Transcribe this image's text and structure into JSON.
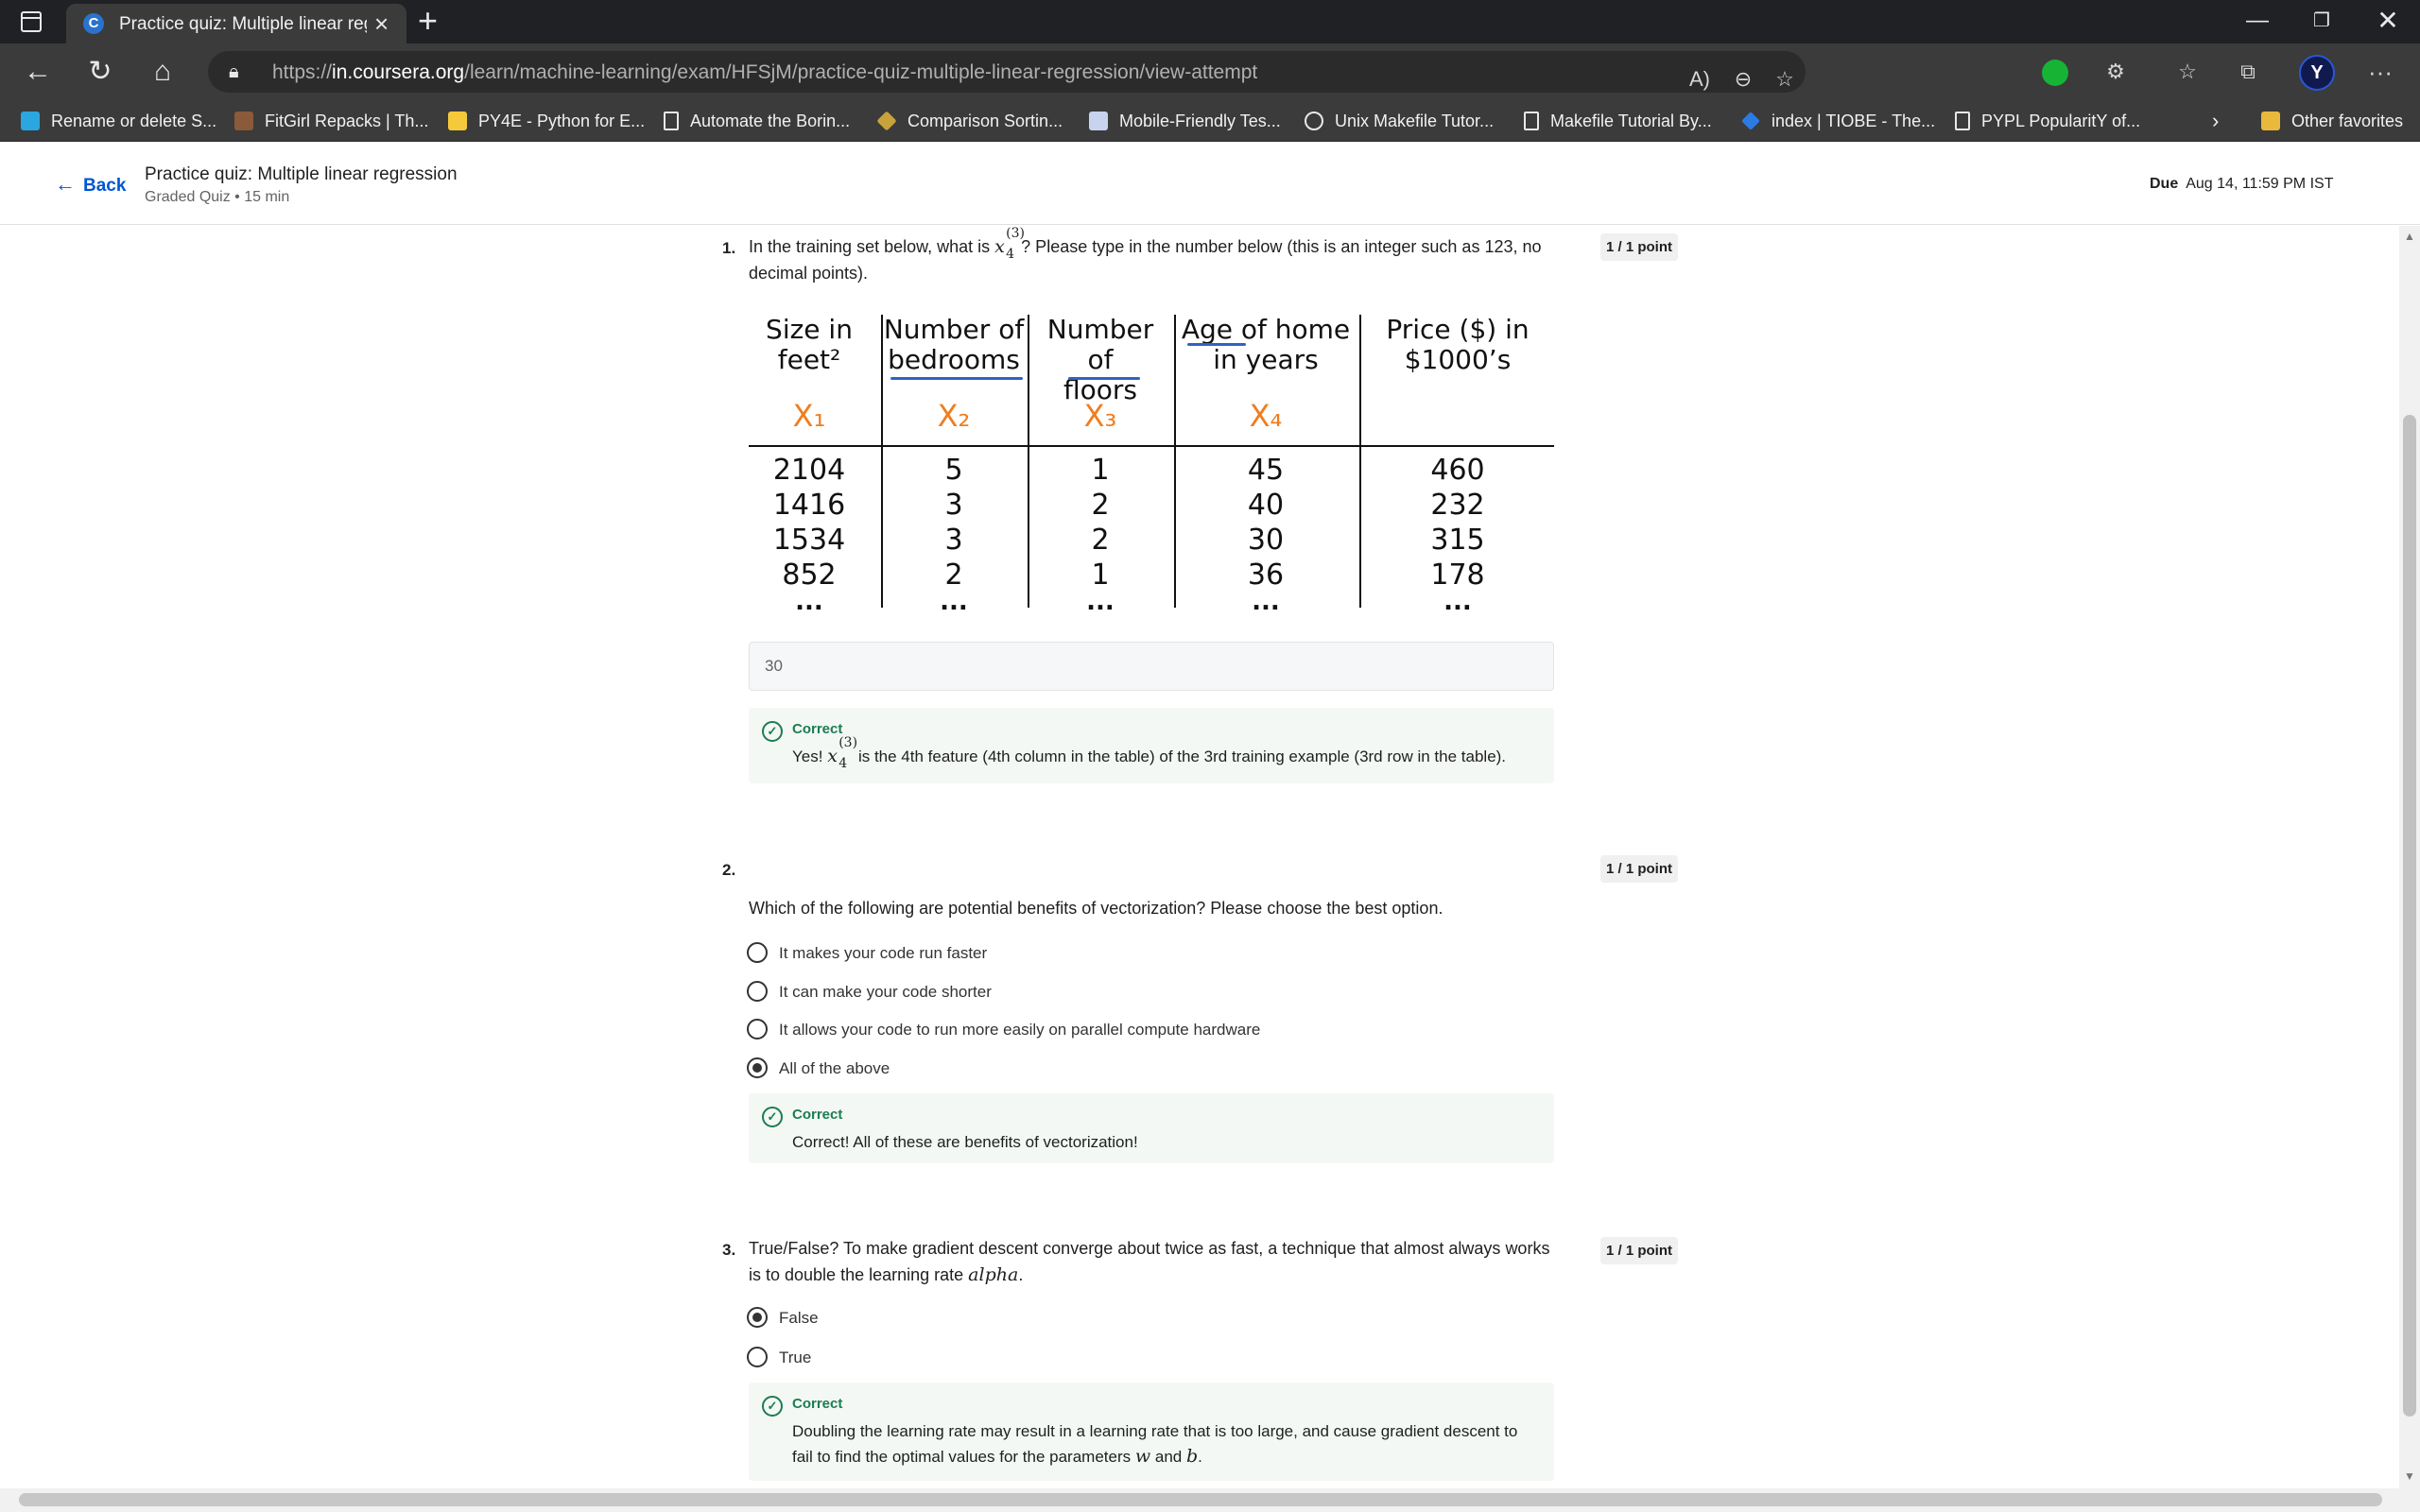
{
  "browser": {
    "tab_title": "Practice quiz: Multiple linear regr",
    "tab_favicon": "C",
    "url_prefix": "https://",
    "url_host": "in.coursera.org",
    "url_path": "/learn/machine-learning/exam/HFSjM/practice-quiz-multiple-linear-regression/view-attempt",
    "profile_initial": "Y",
    "favorites": [
      {
        "label": "Rename or delete S...",
        "icon": "kaggle-k-icon"
      },
      {
        "label": "FitGirl Repacks | Th...",
        "icon": "avatar-icon"
      },
      {
        "label": "PY4E - Python for E...",
        "icon": "python-icon"
      },
      {
        "label": "Automate the Borin...",
        "icon": "page-icon"
      },
      {
        "label": "Comparison Sortin...",
        "icon": "diamond-icon"
      },
      {
        "label": "Mobile-Friendly Tes...",
        "icon": "mobile-test-icon"
      },
      {
        "label": "Unix Makefile Tutor...",
        "icon": "unix-icon"
      },
      {
        "label": "Makefile Tutorial By...",
        "icon": "page-icon"
      },
      {
        "label": "index | TIOBE - The...",
        "icon": "tiobe-icon"
      },
      {
        "label": "PYPL PopularitY of...",
        "icon": "page-icon"
      }
    ],
    "other_favorites": "Other favorites"
  },
  "header": {
    "back_label": "Back",
    "title": "Practice quiz: Multiple linear regression",
    "subtitle": "Graded Quiz • 15 min",
    "due_label": "Due",
    "due_value": "Aug 14, 11:59 PM IST"
  },
  "q1": {
    "number": "1.",
    "text_before": "In the training set below, what is",
    "math_var": "x",
    "math_sup": "(3)",
    "math_sub": "4",
    "text_after": "? Please type in the number below (this is an integer such as 123, no decimal points).",
    "points": "1 / 1 point",
    "table": {
      "headers": [
        {
          "line1": "Size in",
          "line2": "feet²"
        },
        {
          "line1": "Number of",
          "line2": "bedrooms"
        },
        {
          "line1": "Number of",
          "line2": "floors"
        },
        {
          "line1": "Age of home",
          "line2": "in years"
        },
        {
          "line1": "Price ($) in",
          "line2": "$1000’s"
        }
      ],
      "feature_labels": [
        "X₁",
        "X₂",
        "X₃",
        "X₄",
        ""
      ],
      "columns": [
        [
          "2104",
          "1416",
          "1534",
          "852",
          "..."
        ],
        [
          "5",
          "3",
          "3",
          "2",
          "..."
        ],
        [
          "1",
          "2",
          "2",
          "1",
          "..."
        ],
        [
          "45",
          "40",
          "30",
          "36",
          "..."
        ],
        [
          "460",
          "232",
          "315",
          "178",
          "..."
        ]
      ]
    },
    "answer": "30",
    "feedback_title": "Correct",
    "feedback_before": "Yes!",
    "feedback_after": "is the 4th feature (4th column in the table) of the 3rd training example (3rd row in the table)."
  },
  "q2": {
    "number": "2.",
    "text": "Which of the following are potential benefits of vectorization? Please choose the best option.",
    "points": "1 / 1 point",
    "options": [
      {
        "label": "It makes your code run faster",
        "selected": false
      },
      {
        "label": "It can make your code shorter",
        "selected": false
      },
      {
        "label": "It allows your code to run more easily on parallel compute hardware",
        "selected": false
      },
      {
        "label": "All of the above",
        "selected": true
      }
    ],
    "feedback_title": "Correct",
    "feedback_text": "Correct! All of these are benefits of vectorization!"
  },
  "q3": {
    "number": "3.",
    "text": "True/False? To make gradient descent converge about twice as fast, a technique that almost always works is to double the learning rate",
    "math_alpha": "alpha",
    "points": "1 / 1 point",
    "options": [
      {
        "label": "False",
        "selected": true
      },
      {
        "label": "True",
        "selected": false
      }
    ],
    "feedback_title": "Correct",
    "feedback_text_1": "Doubling the learning rate may result in a learning rate that is too large, and cause gradient descent to fail to find the optimal values for the parameters",
    "feedback_w": "w",
    "feedback_and": "and",
    "feedback_b": "b"
  }
}
